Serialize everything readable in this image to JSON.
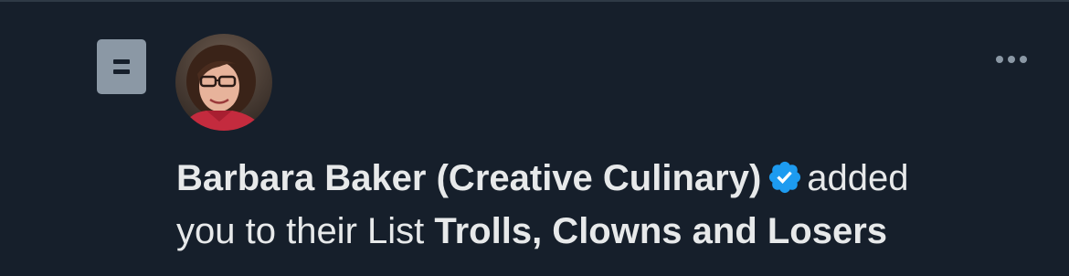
{
  "notification": {
    "type_icon": "list-icon",
    "avatar_icon": "user-avatar-photo",
    "more_icon": "more-options-icon",
    "actor_name": "Barbara Baker (Creative Culinary)",
    "verified_icon": "verified-badge-icon",
    "verb_text": "added",
    "middle_text": "you to their List",
    "list_name": "Trolls, Clowns and Losers"
  },
  "colors": {
    "background": "#161f2b",
    "text": "#e7e9ea",
    "muted": "#8b98a5",
    "verified": "#1d9bf0"
  }
}
